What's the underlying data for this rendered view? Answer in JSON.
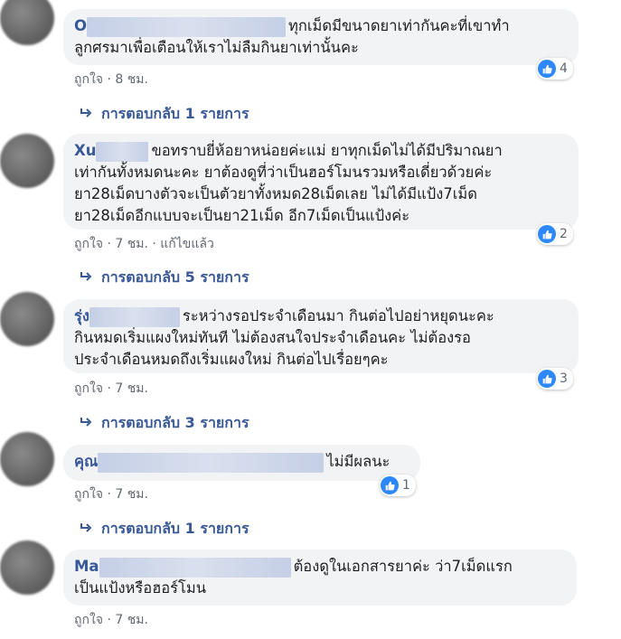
{
  "comments": [
    {
      "author": "O",
      "text": "ทุกเม็ดมีขนาดยาเท่ากันคะที่เขาทำลูกศรมาเพื่อเตือนให้เราไม่ลืมกินยาเท่านั้นคะ",
      "line1": "ทุกเม็ดมีขนาดยาเท่ากันคะที่เขาทำ",
      "line2": "ลูกศรมาเพื่อเตือนให้เราไม่ลืมกินยาเท่านั้นคะ",
      "like_label": "ถูกใจ",
      "time": "8 ชม.",
      "edited": "",
      "reactions": "4",
      "replies": "การตอบกลับ 1 รายการ"
    },
    {
      "author": "Xu",
      "line1": "ขอทราบยี่ห้อยาหน่อยค่ะแม่ ยาทุกเม็ดไม่ได้มีปริมาณยา",
      "line2": "เท่ากันทั้งหมดนะคะ ยาต้องดูที่ว่าเป็นฮอร์โมนรวมหรือเดี่ยวด้วยค่ะ",
      "line3": "ยา28เม็ดบางตัวจะเป็นตัวยาทั้งหมด28เม็ดเลย ไม่ได้มีแป้ง7เม็ด",
      "line4": "ยา28เม็ดอีกแบบจะเป็นยา21เม็ด อีก7เม็ดเป็นแป้งค่ะ",
      "like_label": "ถูกใจ",
      "time": "7 ชม.",
      "edited": "แก้ไขแล้ว",
      "reactions": "2",
      "replies": "การตอบกลับ 5 รายการ"
    },
    {
      "author": "รุ่ง",
      "line1": "ระหว่างรอประจำเดือนมา กินต่อไปอย่าหยุดนะคะ",
      "line2": "กินหมดเริ่มแผงใหม่ทันที ไม่ต้องสนใจประจำเดือนคะ ไม่ต้องรอ",
      "line3": "ประจำเดือนหมดถึงเริ่มแผงใหม่ กินต่อไปเรื่อยๆคะ",
      "like_label": "ถูกใจ",
      "time": "7 ชม.",
      "reactions": "3",
      "replies": "การตอบกลับ 3 รายการ"
    },
    {
      "author": "คุณ",
      "line1": "ไม่มีผลนะ",
      "like_label": "ถูกใจ",
      "time": "7 ชม.",
      "reactions": "1",
      "replies": "การตอบกลับ 1 รายการ"
    },
    {
      "author": "Ma",
      "line1": "ต้องดูในเอกสารยาค่ะ ว่า7เม็ดแรก",
      "line2": "เป็นแป้งหรือฮอร์โมน",
      "like_label": "ถูกใจ",
      "time": "7 ชม."
    }
  ],
  "separator": "·",
  "colors": {
    "link": "#385898",
    "bubble": "#f2f3f5",
    "like": "#2d88ff",
    "meta": "#606770"
  },
  "icons": {
    "like": "thumbs-up-icon",
    "reply": "reply-arrow-icon"
  }
}
